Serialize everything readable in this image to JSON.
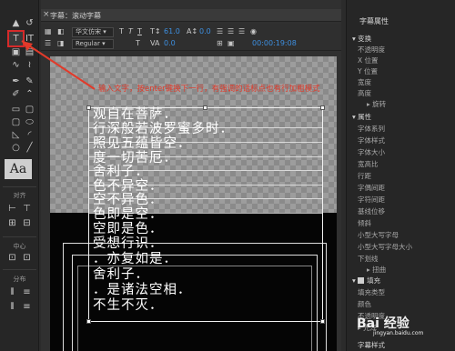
{
  "window": {
    "title": "字幕：滚动字幕",
    "close_glyph": "×"
  },
  "toolbar": {
    "font_family": "华文仿宋",
    "font_style": "Regular",
    "font_size": "61.0",
    "kerning": "0.0",
    "leading": "0.0",
    "timecode": "00:00:19:08",
    "t_glyph": "T"
  },
  "tools": {
    "type_tool": "T",
    "vertical_type_tool": "IT",
    "styles_preview": "Aa",
    "align_label": "对齐",
    "center_label": "中心",
    "distribute_label": "分布"
  },
  "canvas": {
    "hint": "输入文字，按enter键换下一行，有强调的话标点也有行加粗模式",
    "lines": [
      "观自在菩萨．",
      "行深般若波罗蜜多时．",
      "照见五蕴皆空．",
      "度一切苦厄．",
      "舍利子．",
      "色不异空．",
      "空不异色．",
      "色即是空．",
      "空即是色．",
      "受想行识．",
      "．亦复如是．",
      "舍利子．",
      "．是诸法空相．",
      "不生不灭．"
    ]
  },
  "properties": {
    "header": "字幕属性",
    "items": [
      {
        "label": "变换",
        "group": true
      },
      {
        "label": "不透明度",
        "group": false
      },
      {
        "label": "X 位置",
        "group": false
      },
      {
        "label": "Y 位置",
        "group": false
      },
      {
        "label": "宽度",
        "group": false
      },
      {
        "label": "高度",
        "group": false
      },
      {
        "label": "旋转",
        "group": false
      },
      {
        "label": "属性",
        "group": true
      },
      {
        "label": "字体系列",
        "group": false
      },
      {
        "label": "字体样式",
        "group": false
      },
      {
        "label": "字体大小",
        "group": false
      },
      {
        "label": "宽高比",
        "group": false
      },
      {
        "label": "行距",
        "group": false
      },
      {
        "label": "字偶间距",
        "group": false
      },
      {
        "label": "字符间距",
        "group": false
      },
      {
        "label": "基线位移",
        "group": false
      },
      {
        "label": "倾斜",
        "group": false
      },
      {
        "label": "小型大写字母",
        "group": false
      },
      {
        "label": "小型大写字母大小",
        "group": false
      },
      {
        "label": "下划线",
        "group": false
      },
      {
        "label": "扭曲",
        "group": false
      },
      {
        "label": "填充",
        "group": true
      },
      {
        "label": "填充类型",
        "group": false
      },
      {
        "label": "颜色",
        "group": false
      },
      {
        "label": "不透明度",
        "group": false
      },
      {
        "label": "光泽",
        "group": false
      },
      {
        "label": "字幕样式",
        "group": false
      }
    ]
  },
  "watermark": {
    "brand": "Bai 经验",
    "url": "jingyan.baidu.com"
  },
  "colors": {
    "accent_blue": "#3d8fe0",
    "annotation_red": "#e23a2a"
  }
}
